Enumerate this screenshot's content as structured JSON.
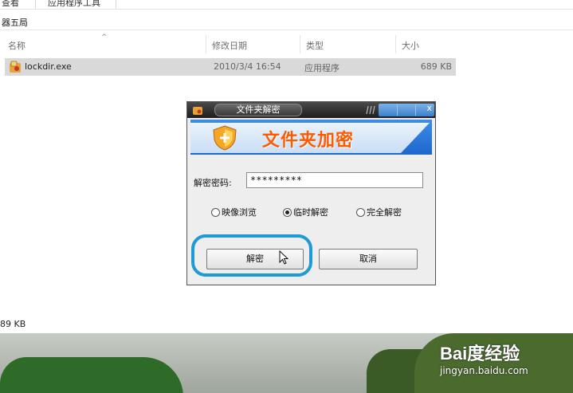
{
  "explorer": {
    "top_fragments": [
      "查看",
      "应用程序工具"
    ],
    "breadcrumb": "器五局",
    "columns": [
      "名称",
      "修改日期",
      "类型",
      "大小"
    ],
    "file": {
      "name": "lockdir.exe",
      "modified": "2010/3/4 16:54",
      "type": "应用程序",
      "size": "689 KB"
    },
    "status_size": "89 KB"
  },
  "dialog": {
    "title": "文件夹解密",
    "banner_title": "文件夹加密",
    "password_label": "解密密码:",
    "password_value": "*********",
    "radio_options": [
      {
        "label": "映像浏览",
        "checked": false
      },
      {
        "label": "临时解密",
        "checked": true
      },
      {
        "label": "完全解密",
        "checked": false
      }
    ],
    "decrypt_button": "解密",
    "cancel_button": "取消"
  },
  "watermark": {
    "logo": "Bai度经验",
    "url": "jingyan.baidu.com"
  },
  "colors": {
    "highlight": "#1e9ad6",
    "banner_blue": "#1f66cc",
    "banner_text": "#ff5a00"
  }
}
